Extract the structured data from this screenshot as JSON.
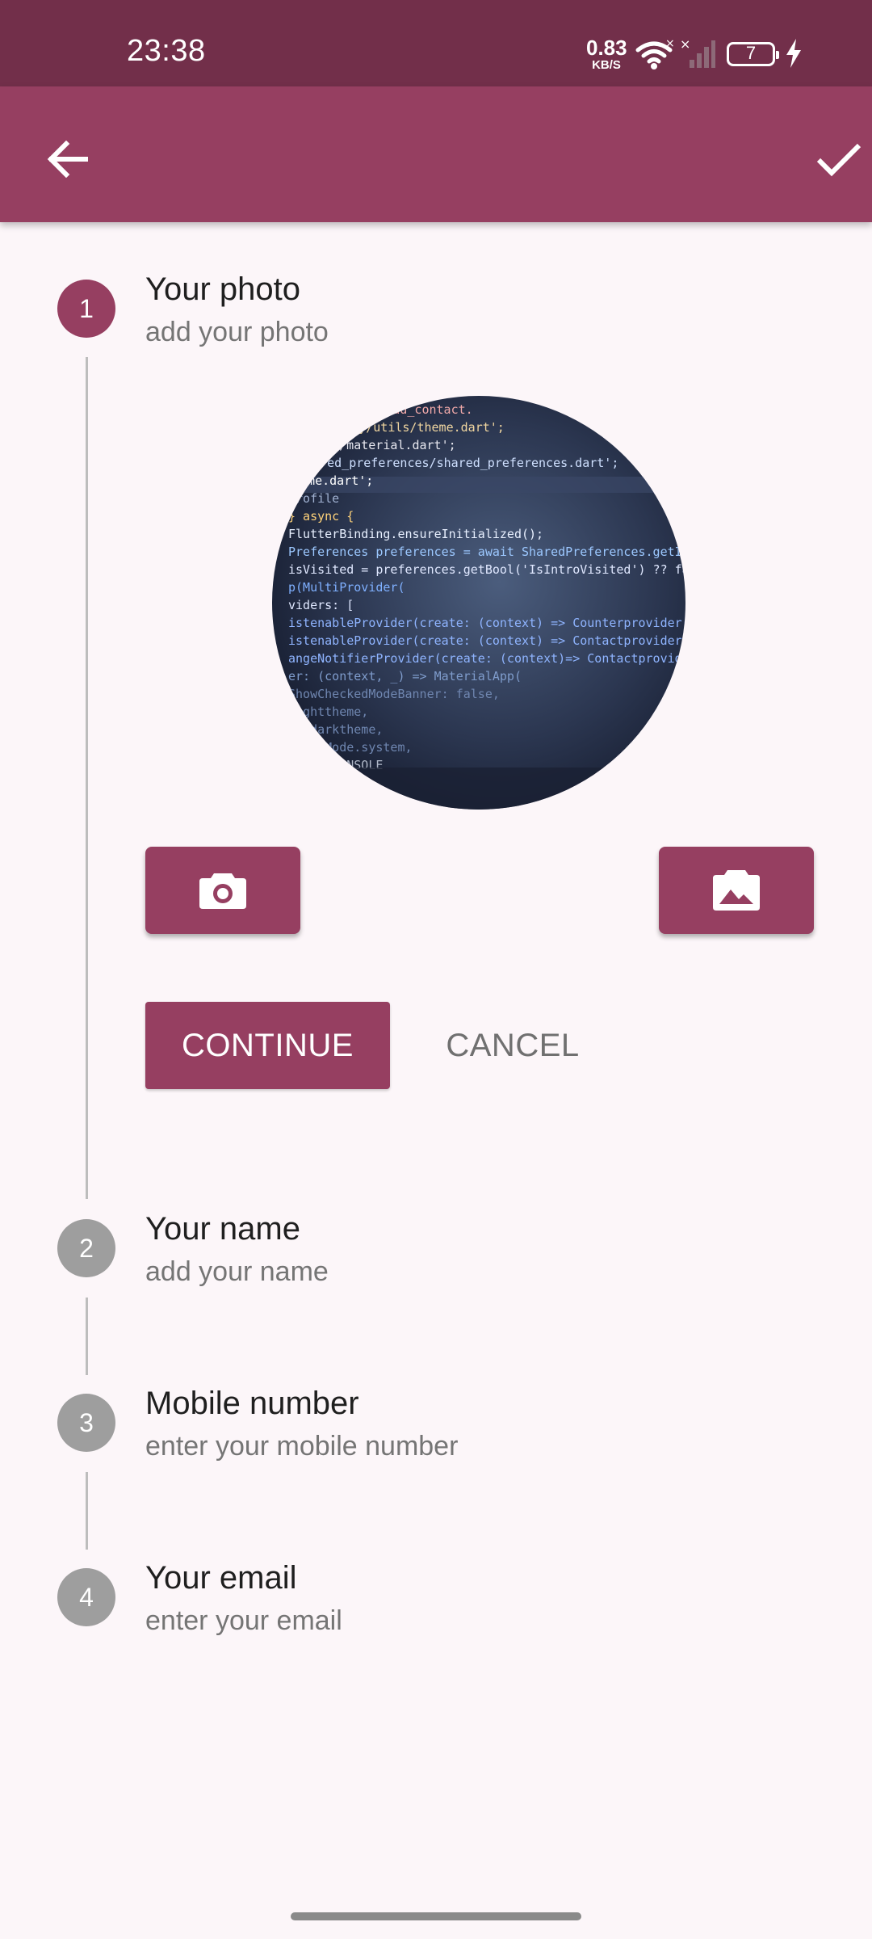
{
  "status_bar": {
    "time": "23:38",
    "net_speed_value": "0.83",
    "net_speed_unit": "KB/S",
    "battery_level": "7",
    "icons": [
      "wifi-icon",
      "signal-icon",
      "battery-icon",
      "charging-icon"
    ]
  },
  "app_bar": {
    "back_icon": "arrow-left-icon",
    "confirm_icon": "check-icon"
  },
  "steps": [
    {
      "number": "1",
      "title": "Your photo",
      "subtitle": "add your photo",
      "state": "active"
    },
    {
      "number": "2",
      "title": "Your name",
      "subtitle": "add your name",
      "state": "inactive"
    },
    {
      "number": "3",
      "title": "Mobile number",
      "subtitle": "enter your mobile number",
      "state": "inactive"
    },
    {
      "number": "4",
      "title": "Your email",
      "subtitle": "enter your email",
      "state": "inactive"
    }
  ],
  "photo_step": {
    "camera_icon": "camera-icon",
    "gallery_icon": "gallery-icon",
    "photo_code_lines": [
      "ary/views/add_contact.",
      "ct_diary/utils/theme.dart';",
      "utter/material.dart';",
      "shared_preferences/shared_preferences.dart';",
      "Home.dart';",
      "Profile",
      "} async {",
      "FlutterBinding.ensureInitialized();",
      "Preferences preferences = await SharedPreferences.getInstance",
      "isVisited = preferences.getBool('IsIntroVisited') ?? false;",
      "p(MultiProvider(",
      "viders: [",
      "istenableProvider(create: (context) => Counterprovider()),",
      "istenableProvider(create: (context) => Contactprovider()),",
      "angeNotifierProvider(create: (context)=> Contactprovider()),",
      "er: (context, _) => MaterialApp(",
      "ShowCheckedModeBanner: false,",
      "lighttheme,",
      "e: darktheme,",
      "ThemeMode.system,",
      "DEBUG CONSOLE"
    ]
  },
  "controls": {
    "continue_label": "CONTINUE",
    "cancel_label": "CANCEL"
  },
  "colors": {
    "status_bar": "#722f4a",
    "primary": "#963f61",
    "inactive_step": "#9e9e9e",
    "background": "#fcf6f9"
  }
}
